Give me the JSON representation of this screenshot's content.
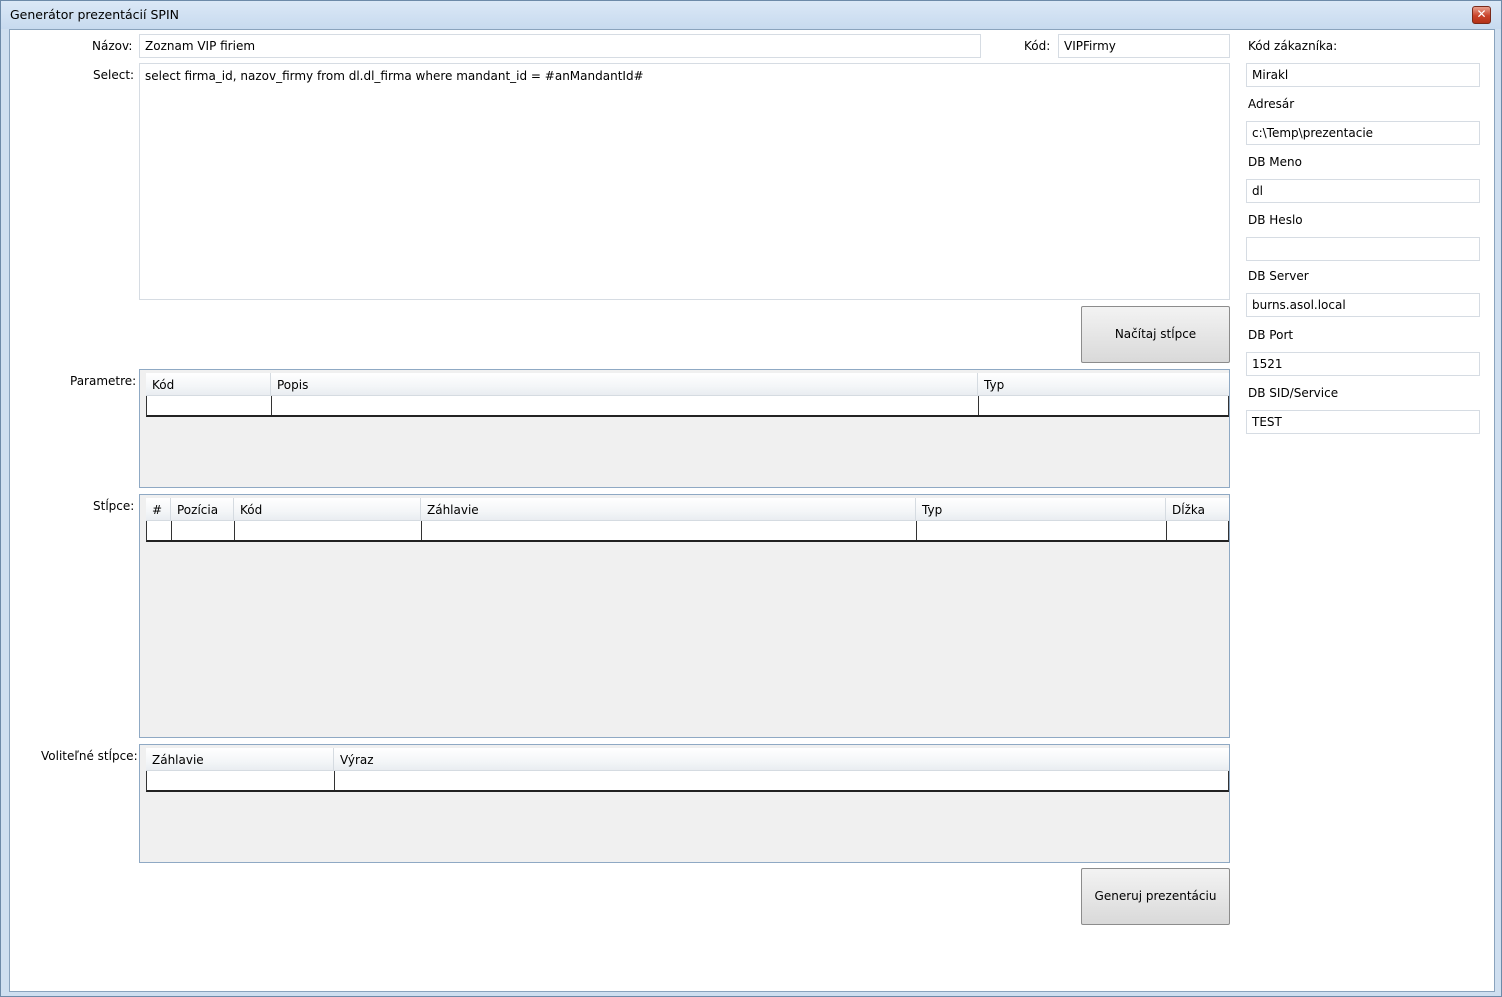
{
  "window": {
    "title": "Generátor prezentácií SPIN",
    "close_glyph": "✕"
  },
  "form": {
    "nazov_label": "Názov:",
    "nazov_value": "Zoznam VIP firiem",
    "kod_label": "Kód:",
    "kod_value": "VIPFirmy",
    "select_label": "Select:",
    "select_value": "select firma_id, nazov_firmy from dl.dl_firma where mandant_id = #anMandantId#",
    "load_button": "Načítaj stĺpce",
    "generate_button": "Generuj prezentáciu"
  },
  "parametre": {
    "label": "Parametre:",
    "columns": [
      "Kód",
      "Popis",
      "Typ"
    ]
  },
  "stlpce": {
    "label": "Stĺpce:",
    "columns": [
      "#",
      "Pozícia",
      "Kód",
      "Záhlavie",
      "Typ",
      "Dĺžka"
    ]
  },
  "volitelne": {
    "label": "Voliteľné stĺpce:",
    "columns": [
      "Záhlavie",
      "Výraz"
    ]
  },
  "sidebar": {
    "kod_zakaznika_label": "Kód zákazníka:",
    "kod_zakaznika_value": "Mirakl",
    "adresar_label": "Adresár",
    "adresar_value": "c:\\Temp\\prezentacie",
    "db_meno_label": "DB Meno",
    "db_meno_value": "dl",
    "db_heslo_label": "DB Heslo",
    "db_heslo_value": "",
    "db_server_label": "DB Server",
    "db_server_value": "burns.asol.local",
    "db_port_label": "DB Port",
    "db_port_value": "1521",
    "db_sid_label": "DB SID/Service",
    "db_sid_value": "TEST"
  }
}
